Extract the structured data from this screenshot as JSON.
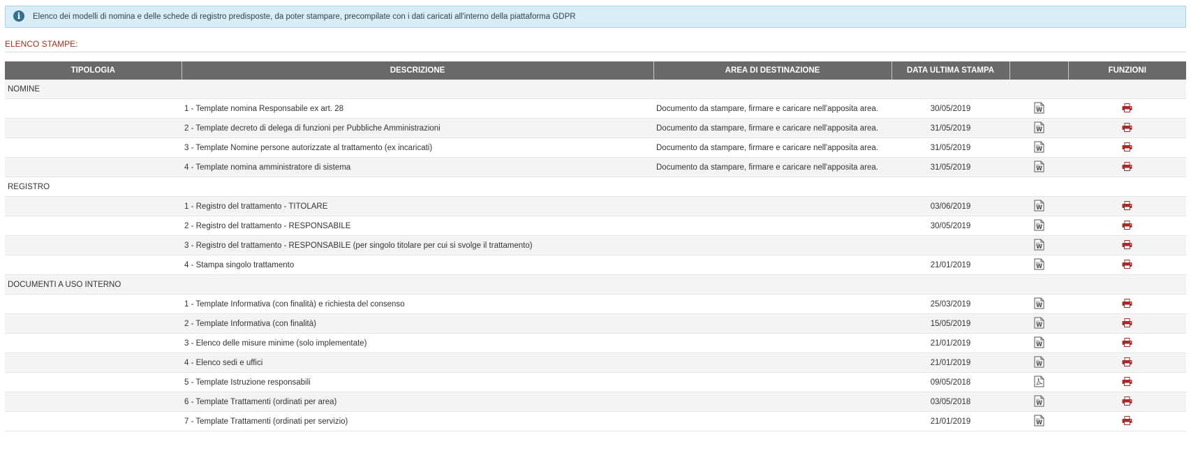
{
  "info": {
    "icon": "info-circle-icon",
    "text": "Elenco dei modelli di nomina e delle schede di registro predisposte, da poter stampare, precompilate con i dati caricati all'interno della piattaforma GDPR"
  },
  "section_title": "ELENCO STAMPE:",
  "colors": {
    "header_bg": "#696969",
    "accent": "#a0301c",
    "info_bg": "#d9edf7",
    "print_icon": "#a52a2a"
  },
  "columns": [
    "TIPOLOGIA",
    "DESCRIZIONE",
    "AREA DI DESTINAZIONE",
    "DATA ULTIMA STAMPA",
    "",
    "FUNZIONI"
  ],
  "groups": [
    {
      "name": "NOMINE",
      "rows": [
        {
          "descrizione": "1 - Template nomina Responsabile ex art. 28",
          "area": "Documento da stampare, firmare e caricare nell'apposita area.",
          "data": "30/05/2019",
          "file_icon": "word-doc-icon",
          "func_icon": "printer-icon"
        },
        {
          "descrizione": "2 - Template decreto di delega di funzioni per Pubbliche Amministrazioni",
          "area": "Documento da stampare, firmare e caricare nell'apposita area.",
          "data": "31/05/2019",
          "file_icon": "word-doc-icon",
          "func_icon": "printer-icon"
        },
        {
          "descrizione": "3 - Template Nomine persone autorizzate al trattamento (ex incaricati)",
          "area": "Documento da stampare, firmare e caricare nell'apposita area.",
          "data": "31/05/2019",
          "file_icon": "word-doc-icon",
          "func_icon": "printer-icon"
        },
        {
          "descrizione": "4 - Template nomina amministratore di sistema",
          "area": "Documento da stampare, firmare e caricare nell'apposita area.",
          "data": "31/05/2019",
          "file_icon": "word-doc-icon",
          "func_icon": "printer-icon"
        }
      ]
    },
    {
      "name": "REGISTRO",
      "rows": [
        {
          "descrizione": "1 - Registro del trattamento - TITOLARE",
          "area": "",
          "data": "03/06/2019",
          "file_icon": "word-doc-icon",
          "func_icon": "printer-icon"
        },
        {
          "descrizione": "2 - Registro del trattamento - RESPONSABILE",
          "area": "",
          "data": "30/05/2019",
          "file_icon": "word-doc-icon",
          "func_icon": "printer-icon"
        },
        {
          "descrizione": "3 - Registro del trattamento - RESPONSABILE (per singolo titolare per cui si svolge il trattamento)",
          "area": "",
          "data": "",
          "file_icon": "word-doc-icon",
          "func_icon": "printer-icon"
        },
        {
          "descrizione": "4 - Stampa singolo trattamento",
          "area": "",
          "data": "21/01/2019",
          "file_icon": "word-doc-icon",
          "func_icon": "printer-icon"
        }
      ]
    },
    {
      "name": "DOCUMENTI A USO INTERNO",
      "rows": [
        {
          "descrizione": "1 - Template Informativa (con finalità) e richiesta del consenso",
          "area": "",
          "data": "25/03/2019",
          "file_icon": "word-doc-icon",
          "func_icon": "printer-icon"
        },
        {
          "descrizione": "2 - Template Informativa (con finalità)",
          "area": "",
          "data": "15/05/2019",
          "file_icon": "word-doc-icon",
          "func_icon": "printer-icon"
        },
        {
          "descrizione": "3 - Elenco delle misure minime (solo implementate)",
          "area": "",
          "data": "21/01/2019",
          "file_icon": "word-doc-icon",
          "func_icon": "printer-icon"
        },
        {
          "descrizione": "4 - Elenco sedi e uffici",
          "area": "",
          "data": "21/01/2019",
          "file_icon": "word-doc-icon",
          "func_icon": "printer-icon"
        },
        {
          "descrizione": "5 - Template Istruzione responsabili",
          "area": "",
          "data": "09/05/2018",
          "file_icon": "pdf-doc-icon",
          "func_icon": "printer-icon"
        },
        {
          "descrizione": "6 - Template Trattamenti (ordinati per area)",
          "area": "",
          "data": "03/05/2018",
          "file_icon": "word-doc-icon",
          "func_icon": "printer-icon"
        },
        {
          "descrizione": "7 - Template Trattamenti (ordinati per servizio)",
          "area": "",
          "data": "21/01/2019",
          "file_icon": "word-doc-icon",
          "func_icon": "printer-icon"
        }
      ]
    }
  ]
}
